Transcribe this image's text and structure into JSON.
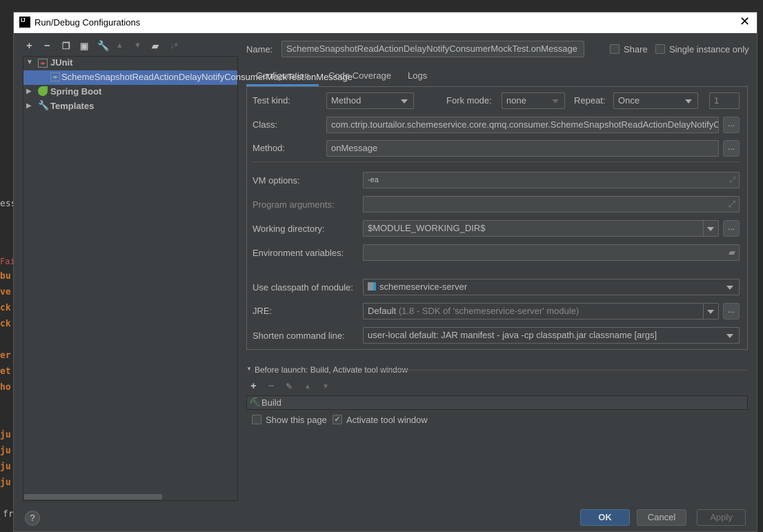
{
  "background": {
    "code_fragments": [
      "essa",
      "Faile",
      "bu",
      "ve",
      "ck",
      "ck",
      "er",
      "et",
      "ho",
      "ju",
      "ju",
      "ju",
      "ju",
      "fr"
    ]
  },
  "dialog": {
    "title": "Run/Debug Configurations",
    "app_icon": "IJ",
    "toolbar": [
      "add-icon",
      "remove-icon",
      "copy-icon",
      "save-icon",
      "wrench-icon",
      "move-up-icon",
      "move-down-icon",
      "new-folder-icon",
      "sort-icon"
    ],
    "tree": [
      {
        "label": "JUnit",
        "expanded": true,
        "children": [
          {
            "label": "SchemeSnapshotReadActionDelayNotifyConsumerMockTest.onMessage",
            "selected": true
          }
        ]
      },
      {
        "label": "Spring Boot",
        "expanded": false
      },
      {
        "label": "Templates",
        "expanded": false
      }
    ],
    "name_label": "Name:",
    "name_value": "SchemeSnapshotReadActionDelayNotifyConsumerMockTest.onMessage",
    "share_label": "Share",
    "share_checked": false,
    "single_label": "Single instance only",
    "single_checked": false,
    "tabs": [
      {
        "label": "Configuration",
        "active": true
      },
      {
        "label": "Code Coverage"
      },
      {
        "label": "Logs"
      }
    ],
    "config": {
      "test_kind_label": "Test kind:",
      "test_kind": "Method",
      "fork_mode_label": "Fork mode:",
      "fork_mode": "none",
      "repeat_label": "Repeat:",
      "repeat": "Once",
      "repeat_count": "1",
      "class_label": "Class:",
      "class_value": "com.ctrip.tourtailor.schemeservice.core.qmq.consumer.SchemeSnapshotReadActionDelayNotifyC",
      "method_label": "Method:",
      "method_value": "onMessage",
      "vm_label": "VM options:",
      "vm_value": "-ea",
      "args_label": "Program arguments:",
      "args_value": "",
      "workdir_label": "Working directory:",
      "workdir_value": "$MODULE_WORKING_DIR$",
      "env_label": "Environment variables:",
      "env_value": "",
      "module_label": "Use classpath of module:",
      "module_value": "schemeservice-server",
      "jre_label": "JRE:",
      "jre_value": "Default",
      "jre_detail": "(1.8 - SDK of 'schemeservice-server' module)",
      "shorten_label": "Shorten command line:",
      "shorten_value": "user-local default: JAR manifest - java -cp classpath.jar classname [args]"
    },
    "before_launch": {
      "title": "Before launch: Build, Activate tool window",
      "items": [
        "Build"
      ],
      "show_page_label": "Show this page",
      "show_page_checked": false,
      "activate_label": "Activate tool window",
      "activate_checked": true
    },
    "buttons": {
      "ok": "OK",
      "cancel": "Cancel",
      "apply": "Apply",
      "help": "?",
      "ellipsis": "..."
    },
    "colors": {
      "accent": "#4b6eaf",
      "ok_button": "#365880",
      "background": "#3c3f41"
    }
  }
}
